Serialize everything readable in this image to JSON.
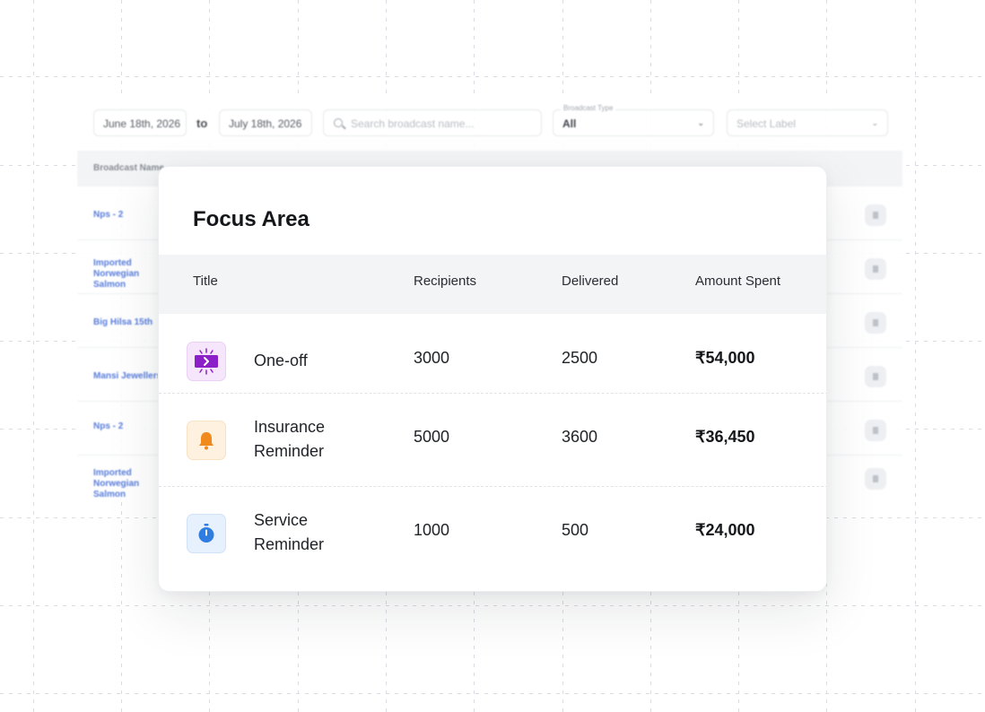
{
  "background_dashboard": {
    "date_from": "June 18th, 2026",
    "to_label": "to",
    "date_to": "July 18th, 2026",
    "search_placeholder": "Search broadcast name...",
    "broadcast_type_label": "Broadcast Type",
    "broadcast_type_value": "All",
    "label_placeholder": "Select Label",
    "column_broadcast_name": "Broadcast Name",
    "rows": [
      {
        "name": "Nps - 2"
      },
      {
        "name": "Imported Norwegian Salmon"
      },
      {
        "name": "Big Hilsa 15th"
      },
      {
        "name": "Mansi Jewellers"
      },
      {
        "name": "Nps - 2"
      },
      {
        "name": "Imported Norwegian Salmon"
      }
    ]
  },
  "card": {
    "title": "Focus Area",
    "headers": {
      "title": "Title",
      "recipients": "Recipients",
      "delivered": "Delivered",
      "amount_spent": "Amount Spent"
    },
    "rows": [
      {
        "icon": "broadcast-icon",
        "title": "One-off",
        "recipients": "3000",
        "delivered": "2500",
        "amount": "₹54,000"
      },
      {
        "icon": "bell-icon",
        "title": "Insurance Reminder",
        "recipients": "5000",
        "delivered": "3600",
        "amount": "₹36,450"
      },
      {
        "icon": "stopwatch-icon",
        "title": "Service Reminder",
        "recipients": "1000",
        "delivered": "500",
        "amount": "₹24,000"
      }
    ]
  },
  "colors": {
    "one_off_icon": "#8b1fc8",
    "insurance_icon": "#f08a1c",
    "service_icon": "#2f7de0",
    "link_blue": "#4a72d8"
  }
}
